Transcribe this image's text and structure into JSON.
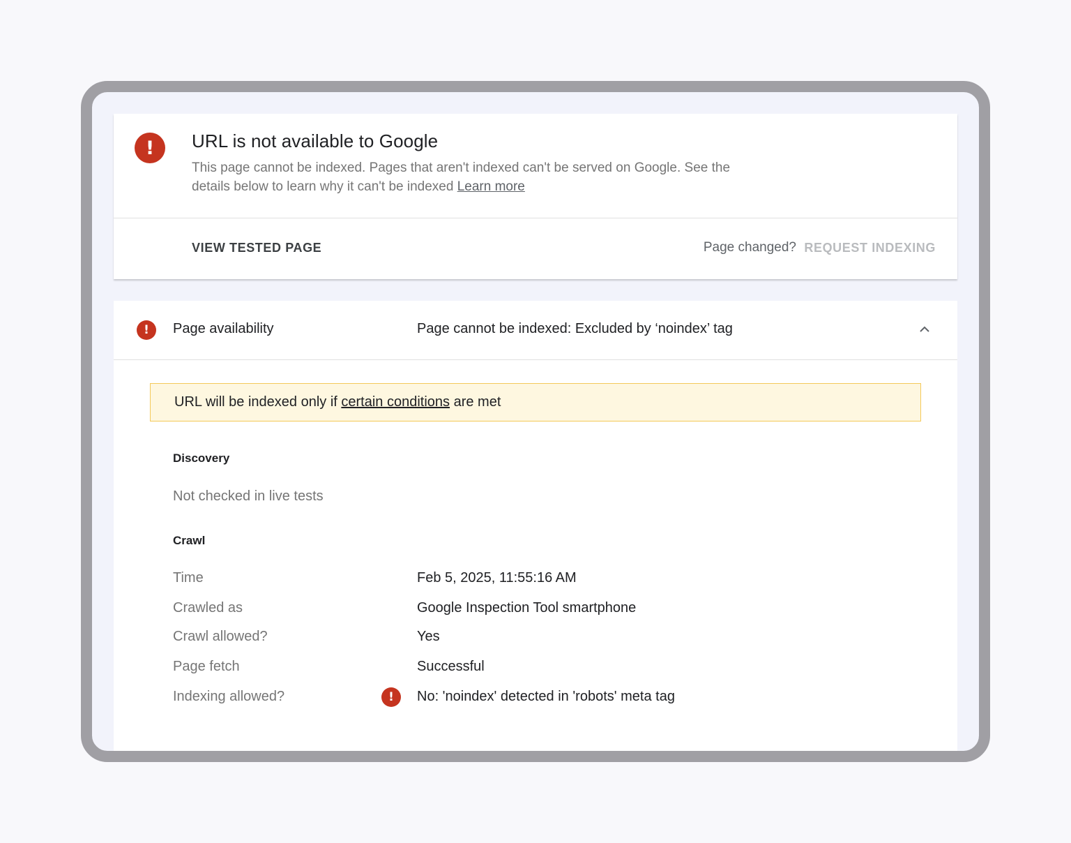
{
  "status": {
    "title": "URL is not available to Google",
    "description": "This page cannot be indexed. Pages that aren't indexed can't be served on Google. See the details below to learn why it can't be indexed",
    "learn_more": "Learn more",
    "icon": "error-icon"
  },
  "actions": {
    "view_tested_page": "VIEW TESTED PAGE",
    "page_changed": "Page changed?",
    "request_indexing": "REQUEST INDEXING"
  },
  "availability": {
    "label": "Page availability",
    "value": "Page cannot be indexed: Excluded by ‘noindex’ tag"
  },
  "warning": {
    "prefix": "URL will be indexed only if ",
    "link": "certain conditions",
    "suffix": " are met"
  },
  "discovery": {
    "heading": "Discovery",
    "text": "Not checked in live tests"
  },
  "crawl": {
    "heading": "Crawl",
    "rows": [
      {
        "label": "Time",
        "value": "Feb 5, 2025, 11:55:16 AM"
      },
      {
        "label": "Crawled as",
        "value": "Google Inspection Tool smartphone"
      },
      {
        "label": "Crawl allowed?",
        "value": "Yes"
      },
      {
        "label": "Page fetch",
        "value": "Successful"
      },
      {
        "label": "Indexing allowed?",
        "value": "No: 'noindex' detected in 'robots' meta tag"
      }
    ]
  },
  "colors": {
    "error": "#c5341f",
    "warning_bg": "#fef7e0",
    "warning_border": "#f4c95a",
    "frame": "#a09fa4"
  }
}
